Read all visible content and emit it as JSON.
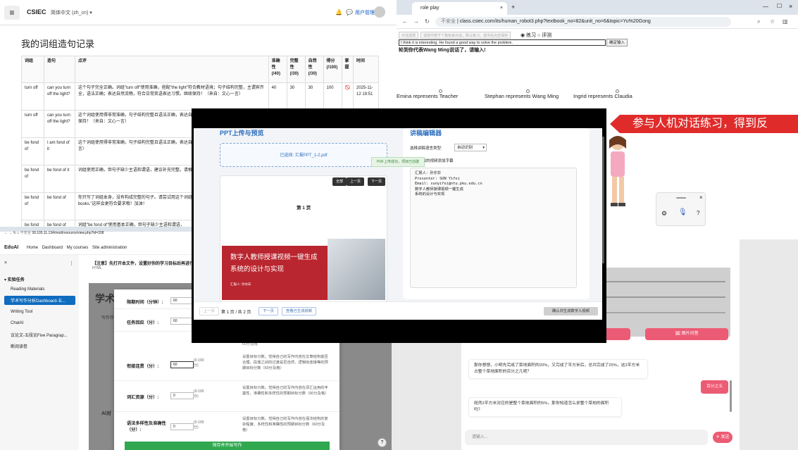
{
  "winA": {
    "brand": "CSIEC",
    "lang": "简体中文 (zh_cn) ▾",
    "user": "用户管理",
    "title": "我的词组造句记录",
    "headers": [
      "词组",
      "造句",
      "点评",
      "准确性(/40)",
      "完整性(/30)",
      "自然性(/30)",
      "得分(/100)",
      "掌握",
      "时间"
    ],
    "rows": [
      {
        "phrase": "turn off",
        "sentence": "can you turn off the light?",
        "comment": "这个句子完全正确。词组\"turn off\"使用准确，搭配\"the light\"符合教材语境；句子结构完整，主谓宾齐全，语法正确；表达自然流畅，符合日常英语表达习惯。继续保持！（来自：文心一言）",
        "acc": "40",
        "comp": "30",
        "nat": "30",
        "score": "100",
        "master": "🚫",
        "time": "2025-11-12 19:51"
      },
      {
        "phrase": "turn off",
        "sentence": "can you turn off the light?",
        "comment": "这个词组使用得非常准确，句子结构完整且语法正确，表达自然流畅，符合日常英语表达习惯。继续保持！（来自：文心一言）",
        "acc": "",
        "comp": "",
        "nat": "",
        "score": "",
        "master": "",
        "time": ""
      },
      {
        "phrase": "be fond of",
        "sentence": "I am fond of it",
        "comment": "这个词组使用得非常准确，句子结构完整且语法正确，表达自然流畅。继续保持！（来自：文心一言）",
        "acc": "",
        "comp": "",
        "nat": "",
        "score": "",
        "master": "",
        "time": ""
      },
      {
        "phrase": "be fond of",
        "sentence": "be fond of it",
        "comment": "词组使用正确，但句子缺少主语和谓语，建议补充完整。请根据语法规则。（来自：文心一言）",
        "acc": "",
        "comp": "",
        "nat": "",
        "score": "",
        "master": "",
        "time": ""
      },
      {
        "phrase": "be fond of",
        "sentence": "be fond of",
        "comment": "你只写了词组本身，没有构成完整的句子。请尝试用这个词组造句，如\"I am fond of reading books.\"这样会更符合要求哦！加油！",
        "acc": "",
        "comp": "",
        "nat": "",
        "score": "",
        "master": "",
        "time": ""
      },
      {
        "phrase": "be fond of",
        "sentence": "be fond of",
        "comment": "词组\"be fond of\"使用基本正确，但句子缺少主语和谓语，",
        "acc": "",
        "comp": "",
        "nat": "",
        "score": "",
        "master": "",
        "time": ""
      }
    ]
  },
  "winB": {
    "tab_title": "role play",
    "url": "class.csiec.com/its/human_robot3.php?textbook_no=82&unit_no=6&topic=Yu%20Gong",
    "security": "不安全",
    "btn1": "对话选择",
    "btn2": "请选中若干个角色来对话，默认练习。选中后点击保存",
    "radio_practice": "练习",
    "radio_eval": "评测",
    "input_value": "I think it is interesting. He found a good way to solve the problem.",
    "send_label": "确定输入",
    "prompt": "轮到你代表Wang Ming说话了，请输入!",
    "roles": [
      "Emina represents Teacher",
      "Stephan represents Wang Ming",
      "Ingrid represents Claudia"
    ],
    "banner": "参与人机对话练习，得到反"
  },
  "winD": {
    "btn_right": "图片问答",
    "msg1": "那你想想，小明先完成了菜地面积的20%，又完成了平方米后，总共完成了25%，这2平方米占整个菜地面积的百分之几呢？",
    "msg_user": "百分之五",
    "msg2": "既然2平方米对应的是整个菜地面积的5%，那你知道怎么求整个菜地的面积吗？",
    "input_placeholder": "请输入...",
    "send_label": "发送"
  },
  "winC": {
    "address": "39.105.11.134/mod/resource/view.php?id=208",
    "security": "不安全",
    "brand": "EduAI",
    "menu": [
      "Home",
      "Dashboard",
      "My courses",
      "Site administration"
    ],
    "side_section": "实验任务",
    "side_items": [
      "Reading Materials",
      "学术写作分析Dashboard-五...",
      "Writing Tool",
      "ChatAI",
      "议论文-五段论Five Paragrap...",
      "断阅读卷"
    ],
    "notice": "【注意】先打开本文件，设置好你的学习目标后再进行",
    "notice_sub": "HTML",
    "bg_title": "学术",
    "bg_sub": "写作作",
    "bg_ai": "AI对",
    "fields": [
      {
        "label": "限期时间（分钟）:",
        "value": "60",
        "range": "",
        "desc": ""
      },
      {
        "label": "任务回应（分）:",
        "value": "60",
        "range": "",
        "desc": ""
      },
      {
        "label": "衔接连贯（分）:",
        "value": "60",
        "range": "(0-100分)",
        "desc": "设置目标分数。觉得自己的写作内容在文章结构能否合理、段落之间的过渡是否自然、逻辑衔连接等的预期目标分数（60分及格）"
      },
      {
        "label": "词汇资源（分）:",
        "value": "0",
        "range": "(0-100分)",
        "desc": "设置目标分数。觉得自己的写作内容在词汇运用的丰富性、准确性和多样性的预期目标分数（60分及格）"
      },
      {
        "label": "语法多样性及准确性（分）:",
        "value": "0",
        "range": "(0-100分)",
        "desc": "设置目标分数。觉得自己的写作内容在语法结构的复杂程度、多样性和准确性的预期目标分数（60分及格）"
      }
    ],
    "greenbtn": "保存并开始写作",
    "mid_label": "60分及格"
  },
  "winE": {
    "left_title": "PPT上传与预览",
    "right_title": "讲稿编辑器",
    "selected_file": "已选择: 汇报PPT_1-2.pdf",
    "toast": "PDF上传成功，项目已创建",
    "btn_all": "全部",
    "btn_prev": "上一页",
    "btn_next": "下一页",
    "page_label": "第 1 页",
    "slide_title_1": "数字人教师授课视频一键生成",
    "slide_title_2": "系统的设计与实现",
    "slide_name": "汇报人: 孙亦非",
    "lang_label": "选择讲稿语言类型:",
    "lang_value": "自动识别",
    "subtitle_check": "为生成的视频添加字幕",
    "script_text": "汇报人：孙亦非\nPresenter: SUN Yifei\nEmail: sunyifei@ntu.pku.edu.cn\n数字人教师授课视频一键生成\n系统的设计与实现",
    "footer_prev": "上一页",
    "page_info": "第 1 页 / 共 2 页",
    "footer_next": "下一页",
    "view_video": "查看已生成视频",
    "confirm_btn": "确认并生成数字人视频"
  }
}
